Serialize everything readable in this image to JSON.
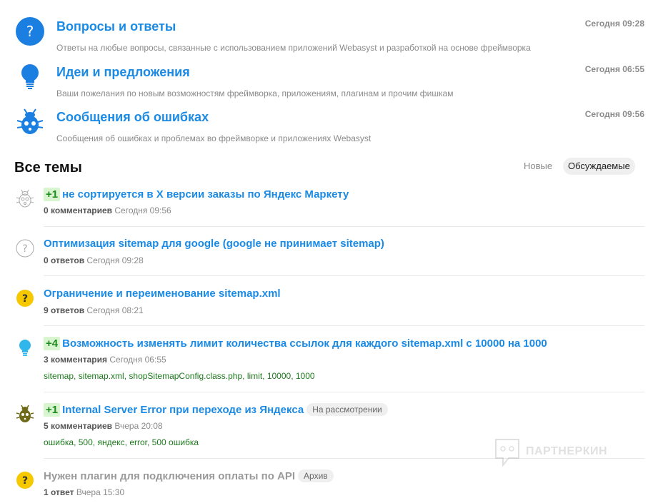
{
  "categories": [
    {
      "title": "Вопросы и ответы",
      "desc": "Ответы на любые вопросы, связанные с использованием приложений Webasyst и разработкой на основе фреймворка",
      "time": "Сегодня 09:28",
      "icon": "question-icon"
    },
    {
      "title": "Идеи и предложения",
      "desc": "Ваши пожелания по новым возможностям фреймворка, приложениям, плагинам и прочим фишкам",
      "time": "Сегодня 06:55",
      "icon": "lightbulb-icon"
    },
    {
      "title": "Сообщения об ошибках",
      "desc": "Сообщения об ошибках и проблемах во фреймворке и приложениях Webasyst",
      "time": "Сегодня 09:56",
      "icon": "bug-icon"
    }
  ],
  "all_topics": {
    "title": "Все темы",
    "tabs": {
      "new": "Новые",
      "discussed": "Обсуждаемые"
    }
  },
  "topics": [
    {
      "vote": "+1",
      "title": "не сортируется в X версии заказы по Яндекс Маркету",
      "count": "0 комментариев",
      "time": "Сегодня 09:56",
      "icon": "bug-outline-icon"
    },
    {
      "vote": "",
      "title": "Оптимизация sitemap для google (google не принимает sitemap)",
      "count": "0 ответов",
      "time": "Сегодня 09:28",
      "icon": "question-outline-icon"
    },
    {
      "vote": "",
      "title": "Ограничение и переименование sitemap.xml",
      "count": "9 ответов",
      "time": "Сегодня 08:21",
      "icon": "question-yellow-icon"
    },
    {
      "vote": "+4",
      "title": "Возможность изменять лимит количества ссылок для каждого sitemap.xml с 10000 на 1000",
      "count": "3 комментария",
      "time": "Сегодня 06:55",
      "icon": "lightbulb-icon",
      "tags": [
        "sitemap",
        "sitemap.xml",
        "shopSitemapConfig.class.php",
        "limit",
        "10000",
        "1000"
      ]
    },
    {
      "vote": "+1",
      "title": "Internal Server Error при переходе из Яндекса",
      "status": "На рассмотрении",
      "count": "5 комментариев",
      "time": "Вчера 20:08",
      "icon": "bug-olive-icon",
      "tags": [
        "ошибка",
        "500",
        "яндекс",
        "error",
        "500 ошибка"
      ]
    },
    {
      "vote": "",
      "title": "Нужен плагин для подключения оплаты по API",
      "status": "Архив",
      "count": "1 ответ",
      "time": "Вчера 15:30",
      "icon": "question-yellow-icon"
    }
  ],
  "watermark": "ПАРТНЕРКИН"
}
